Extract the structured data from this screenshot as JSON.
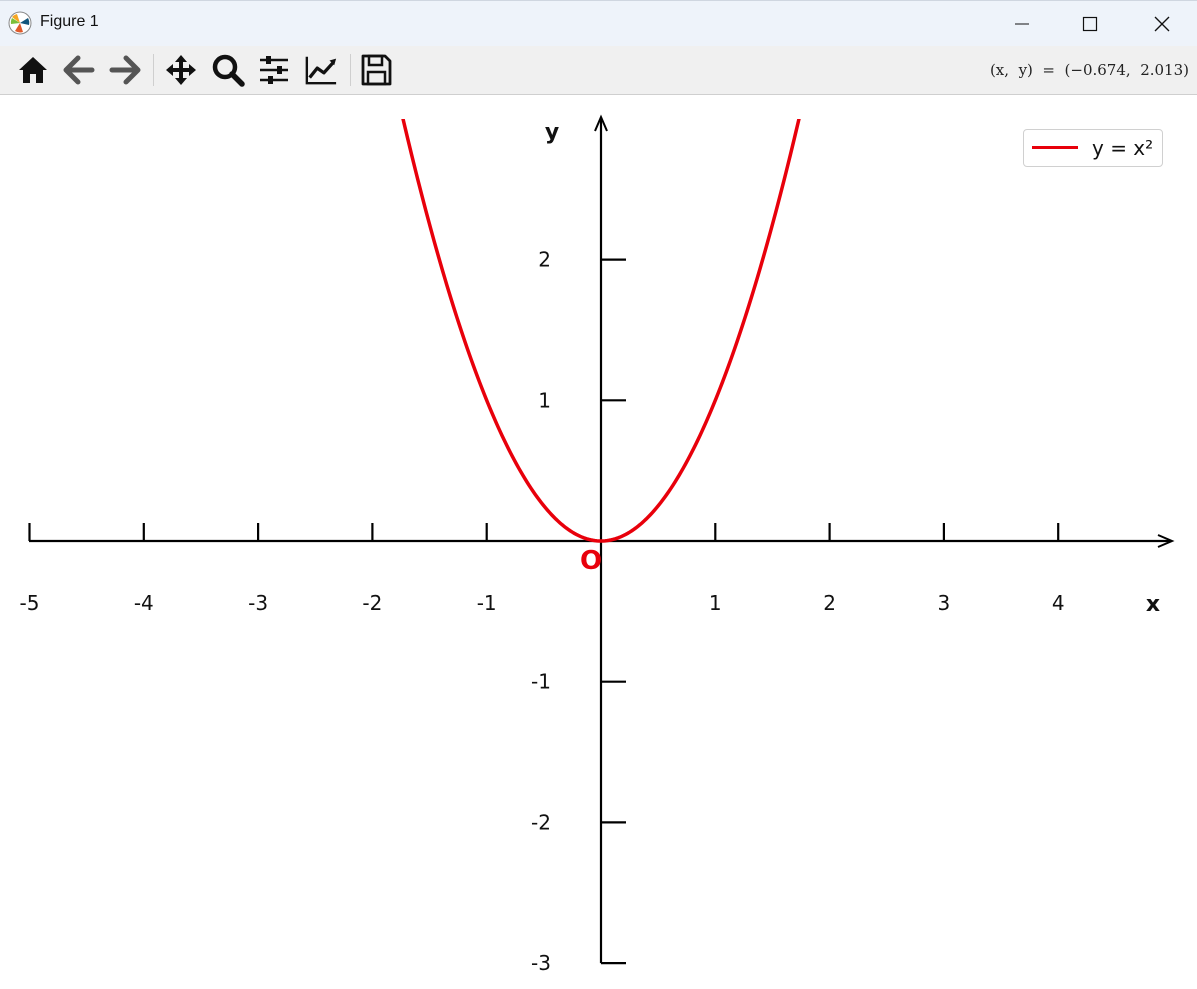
{
  "window": {
    "title": "Figure 1",
    "controls": {
      "minimize": "minimize",
      "maximize": "maximize",
      "close": "close"
    }
  },
  "toolbar": {
    "tools": [
      {
        "name": "home",
        "icon": "home-icon"
      },
      {
        "name": "back",
        "icon": "arrow-left-icon"
      },
      {
        "name": "forward",
        "icon": "arrow-right-icon"
      },
      {
        "name": "pan",
        "icon": "move-icon"
      },
      {
        "name": "zoom",
        "icon": "magnifier-icon"
      },
      {
        "name": "configure-subplots",
        "icon": "sliders-icon"
      },
      {
        "name": "edit-axis",
        "icon": "chart-line-icon"
      },
      {
        "name": "save",
        "icon": "floppy-disk-icon"
      }
    ],
    "coordinates": "(x,  y)  =  (−0.674,  2.013)"
  },
  "colors": {
    "curve": "#e8000b",
    "axes": "#000000",
    "origin_label": "#e8000b"
  },
  "chart_data": {
    "type": "line",
    "title": "",
    "xlabel": "x",
    "ylabel": "y",
    "xlim": [
      -5,
      5
    ],
    "ylim": [
      -3,
      2.9
    ],
    "xticks": [
      -5,
      -4,
      -3,
      -2,
      -1,
      1,
      2,
      3,
      4
    ],
    "xtick_labels": [
      "-5",
      "-4",
      "-3",
      "-2",
      "-1",
      "1",
      "2",
      "3",
      "4"
    ],
    "yticks": [
      2,
      1,
      -1,
      -2,
      -3
    ],
    "ytick_labels": [
      "2",
      "1",
      "-1",
      "-2",
      "-3"
    ],
    "origin_label": "O",
    "grid": false,
    "legend_position": "top-right",
    "series": [
      {
        "name": "y = x²",
        "function": "x^2",
        "x": [
          -1.8,
          -1.6,
          -1.4,
          -1.2,
          -1.0,
          -0.8,
          -0.6,
          -0.4,
          -0.2,
          0,
          0.2,
          0.4,
          0.6,
          0.8,
          1.0,
          1.2,
          1.4,
          1.6,
          1.8
        ],
        "y": [
          3.24,
          2.56,
          1.96,
          1.44,
          1.0,
          0.64,
          0.36,
          0.16,
          0.04,
          0,
          0.04,
          0.16,
          0.36,
          0.64,
          1.0,
          1.44,
          1.96,
          2.56,
          3.24
        ]
      }
    ]
  }
}
